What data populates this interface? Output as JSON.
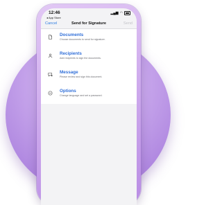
{
  "status_bar": {
    "time": "12:46",
    "back_app": "◂ App Store"
  },
  "navbar": {
    "cancel": "Cancel",
    "title": "Send for Signature",
    "send": "Send"
  },
  "items": [
    {
      "title": "Documents",
      "subtitle": "Choose documents to send for signature.",
      "icon": "document-icon"
    },
    {
      "title": "Recipients",
      "subtitle": "Add recipients to sign the documents.",
      "icon": "person-icon"
    },
    {
      "title": "Message",
      "subtitle": "Please review and sign this document.",
      "icon": "message-icon"
    },
    {
      "title": "Options",
      "subtitle": "Change language and set a password.",
      "icon": "options-icon"
    }
  ],
  "colors": {
    "accent": "#2f6ed8",
    "link": "#2f7de1",
    "backdrop": "#b48ae3"
  }
}
